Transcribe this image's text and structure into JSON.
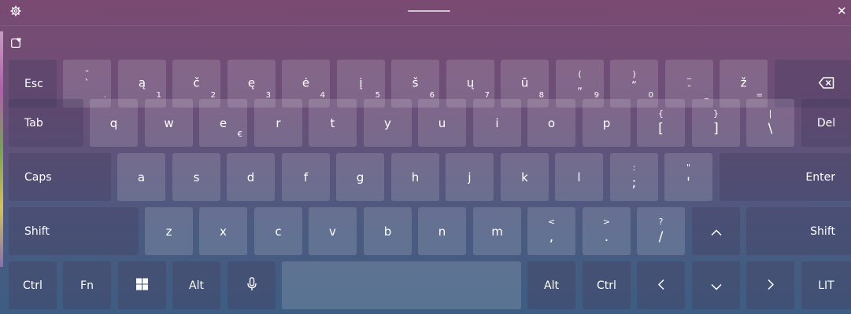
{
  "window": {
    "settings_icon": "gear-icon",
    "close_glyph": "✕",
    "toolbar_icon": "clipboard-heart-icon"
  },
  "rows": {
    "numbers": {
      "esc": "Esc",
      "keys": [
        {
          "main": "",
          "shift": "˜",
          "alt": "`",
          "sub": "."
        },
        {
          "main": "ą",
          "sub": "1"
        },
        {
          "main": "č",
          "sub": "2"
        },
        {
          "main": "ę",
          "sub": "3"
        },
        {
          "main": "ė",
          "sub": "4"
        },
        {
          "main": "į",
          "sub": "5"
        },
        {
          "main": "š",
          "sub": "6"
        },
        {
          "main": "ų",
          "sub": "7"
        },
        {
          "main": "ū",
          "sub": "8"
        },
        {
          "main": "„",
          "shift": "(",
          "sub": "9"
        },
        {
          "main": "“",
          "shift": ")",
          "sub": "0"
        },
        {
          "main": "-",
          "shift": "_",
          "sub": "_"
        },
        {
          "main": "ž",
          "sub": "="
        }
      ],
      "backspace_icon": "backspace-icon"
    },
    "qwerty": {
      "tab": "Tab",
      "letters": [
        "q",
        "w",
        "e",
        "r",
        "t",
        "y",
        "u",
        "i",
        "o",
        "p"
      ],
      "e_alt": "€",
      "brackets": [
        {
          "shift": "{",
          "main": "["
        },
        {
          "shift": "}",
          "main": "]"
        },
        {
          "shift": "|",
          "main": "\\"
        }
      ],
      "del": "Del"
    },
    "home": {
      "caps": "Caps",
      "letters": [
        "a",
        "s",
        "d",
        "f",
        "g",
        "h",
        "j",
        "k",
        "l"
      ],
      "punct": [
        {
          "shift": ":",
          "main": ";"
        },
        {
          "shift": "\"",
          "main": "'"
        }
      ],
      "enter": "Enter"
    },
    "bottom": {
      "shift": "Shift",
      "letters": [
        "z",
        "x",
        "c",
        "v",
        "b",
        "n",
        "m"
      ],
      "punct": [
        {
          "shift": "<",
          "main": ","
        },
        {
          "shift": ">",
          "main": "."
        },
        {
          "shift": "?",
          "main": "/"
        }
      ],
      "up": "^",
      "shift_right": "Shift"
    },
    "control": {
      "ctrl": "Ctrl",
      "fn": "Fn",
      "win_icon": "windows-logo-icon",
      "alt": "Alt",
      "mic_icon": "microphone-icon",
      "alt_right": "Alt",
      "ctrl_right": "Ctrl",
      "left": "‹",
      "down": "˅",
      "right": "›",
      "lang": "LIT"
    }
  }
}
